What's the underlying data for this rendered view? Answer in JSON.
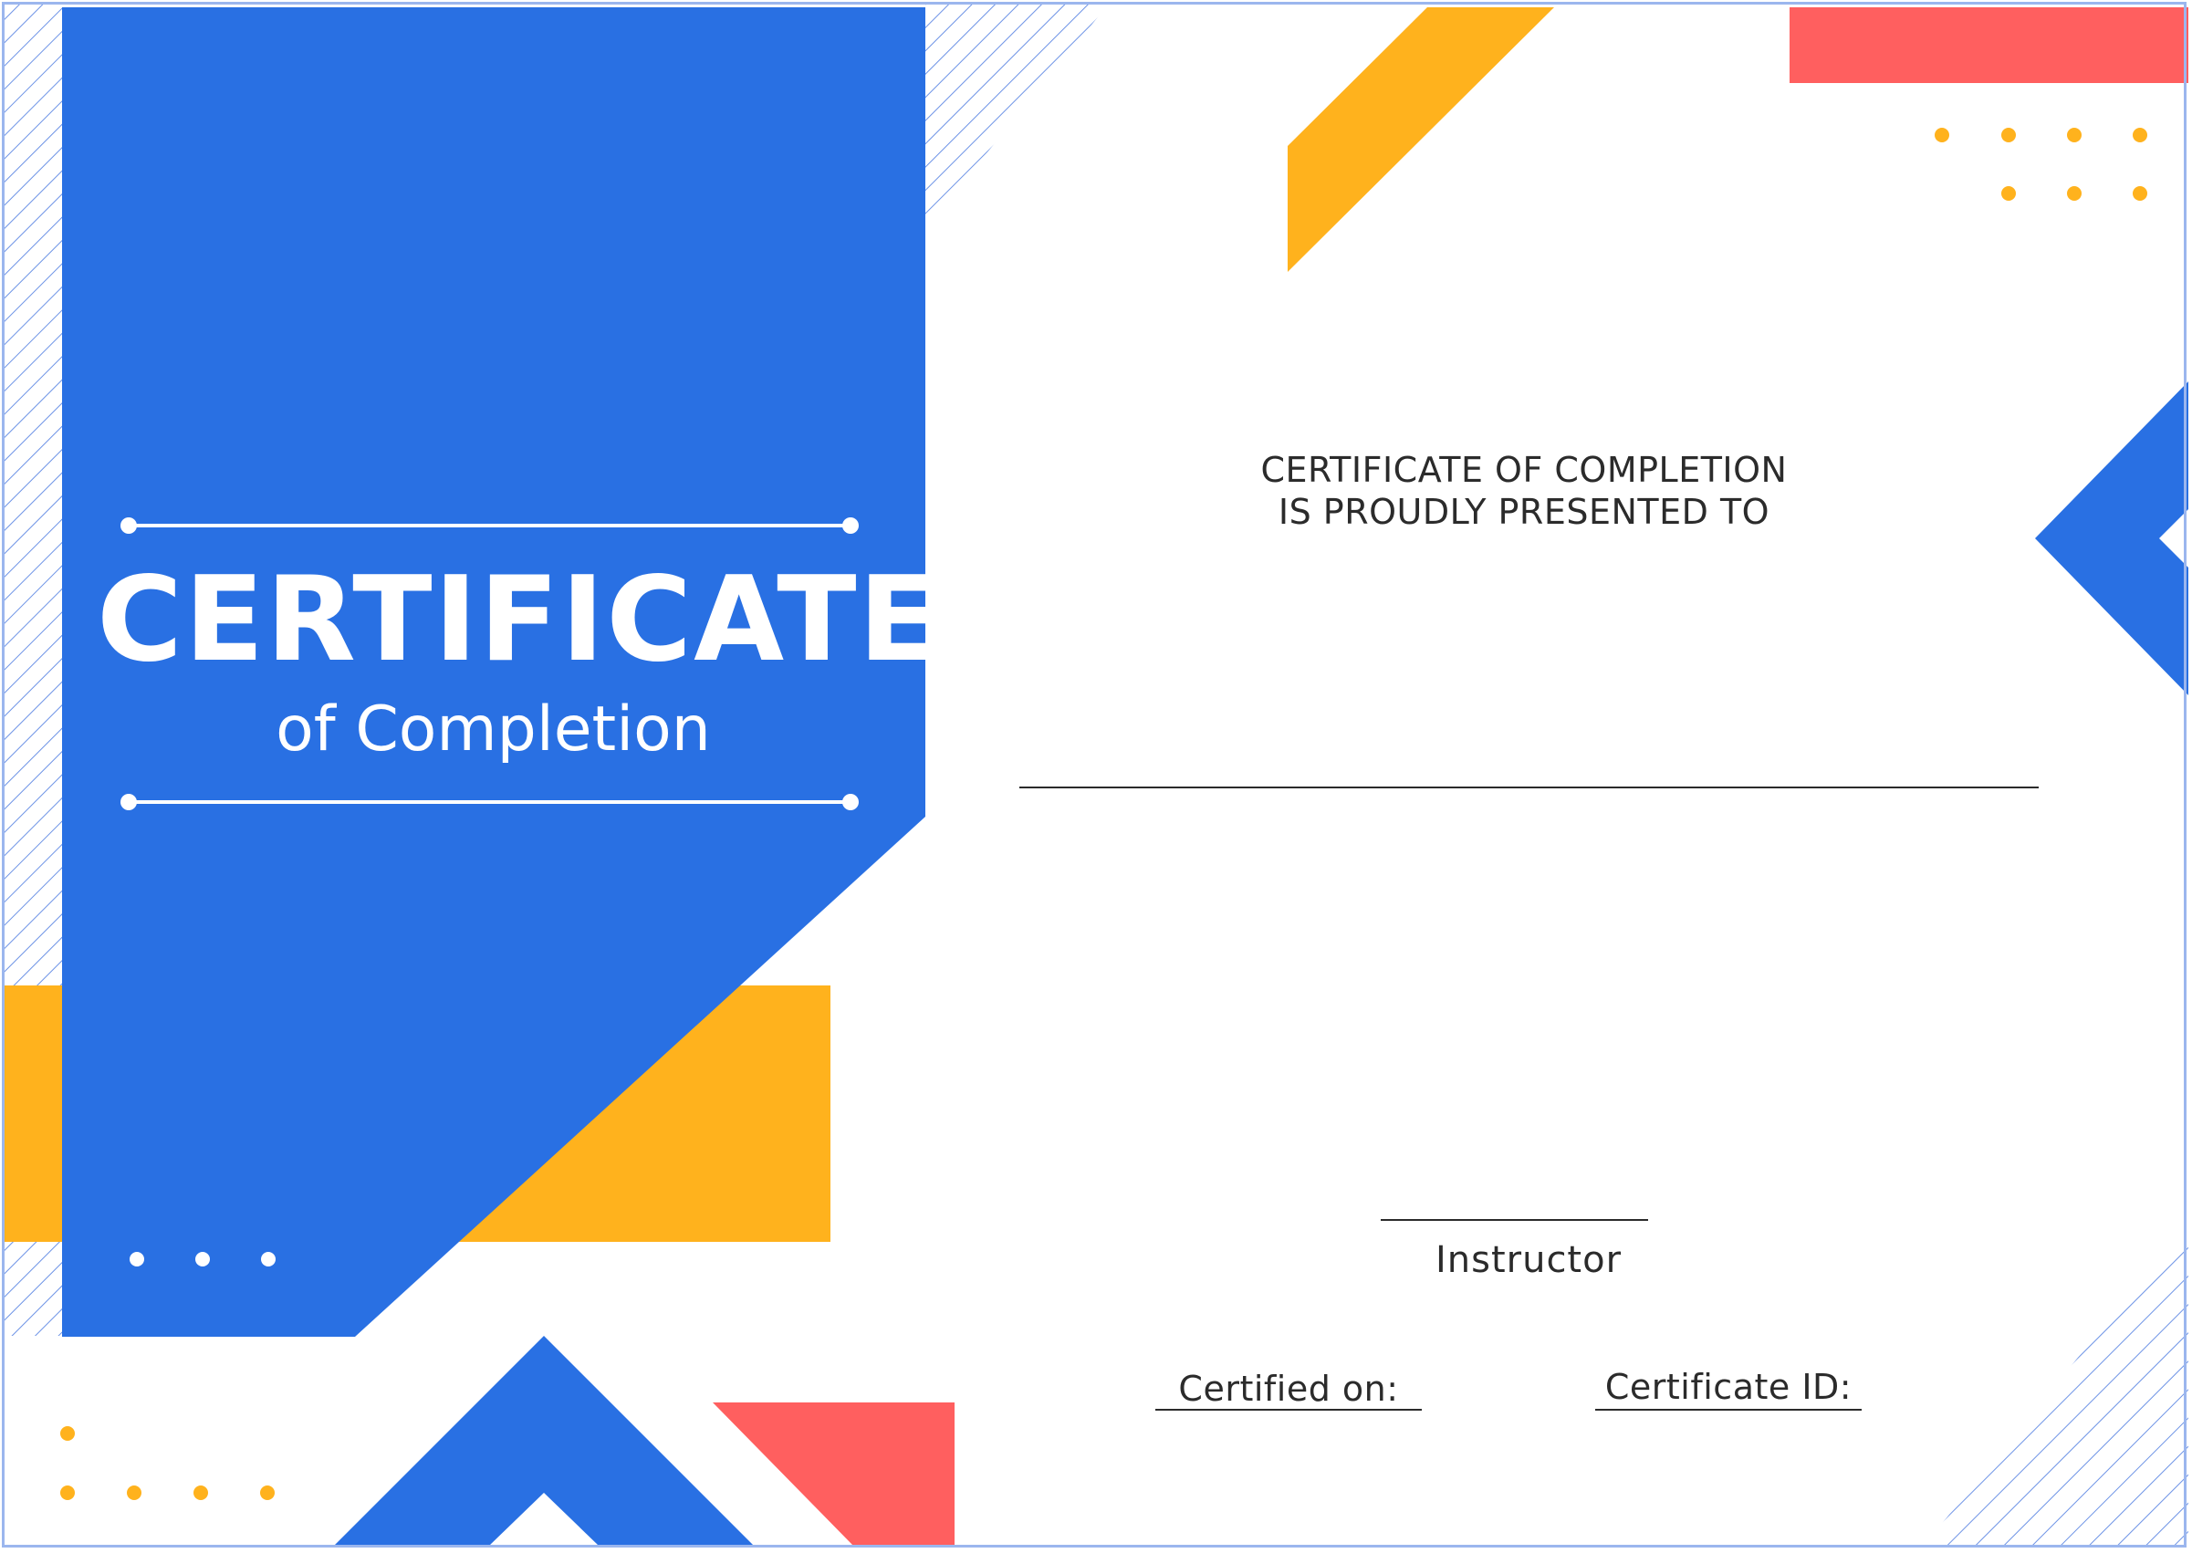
{
  "banner": {
    "title": "CERTIFICATE",
    "subtitle": "of Completion"
  },
  "body": {
    "presented_line1": "CERTIFICATE OF COMPLETION",
    "presented_line2": "IS PROUDLY PRESENTED TO"
  },
  "signatures": {
    "instructor_label": "Instructor",
    "certified_on_label": "Certified on:",
    "certificate_id_label": "Certificate ID:"
  },
  "colors": {
    "blue": "#2970e3",
    "yellow": "#ffb21d",
    "red": "#ff5f5f",
    "frame": "#9bb6ee",
    "text": "#2b2b2b"
  }
}
